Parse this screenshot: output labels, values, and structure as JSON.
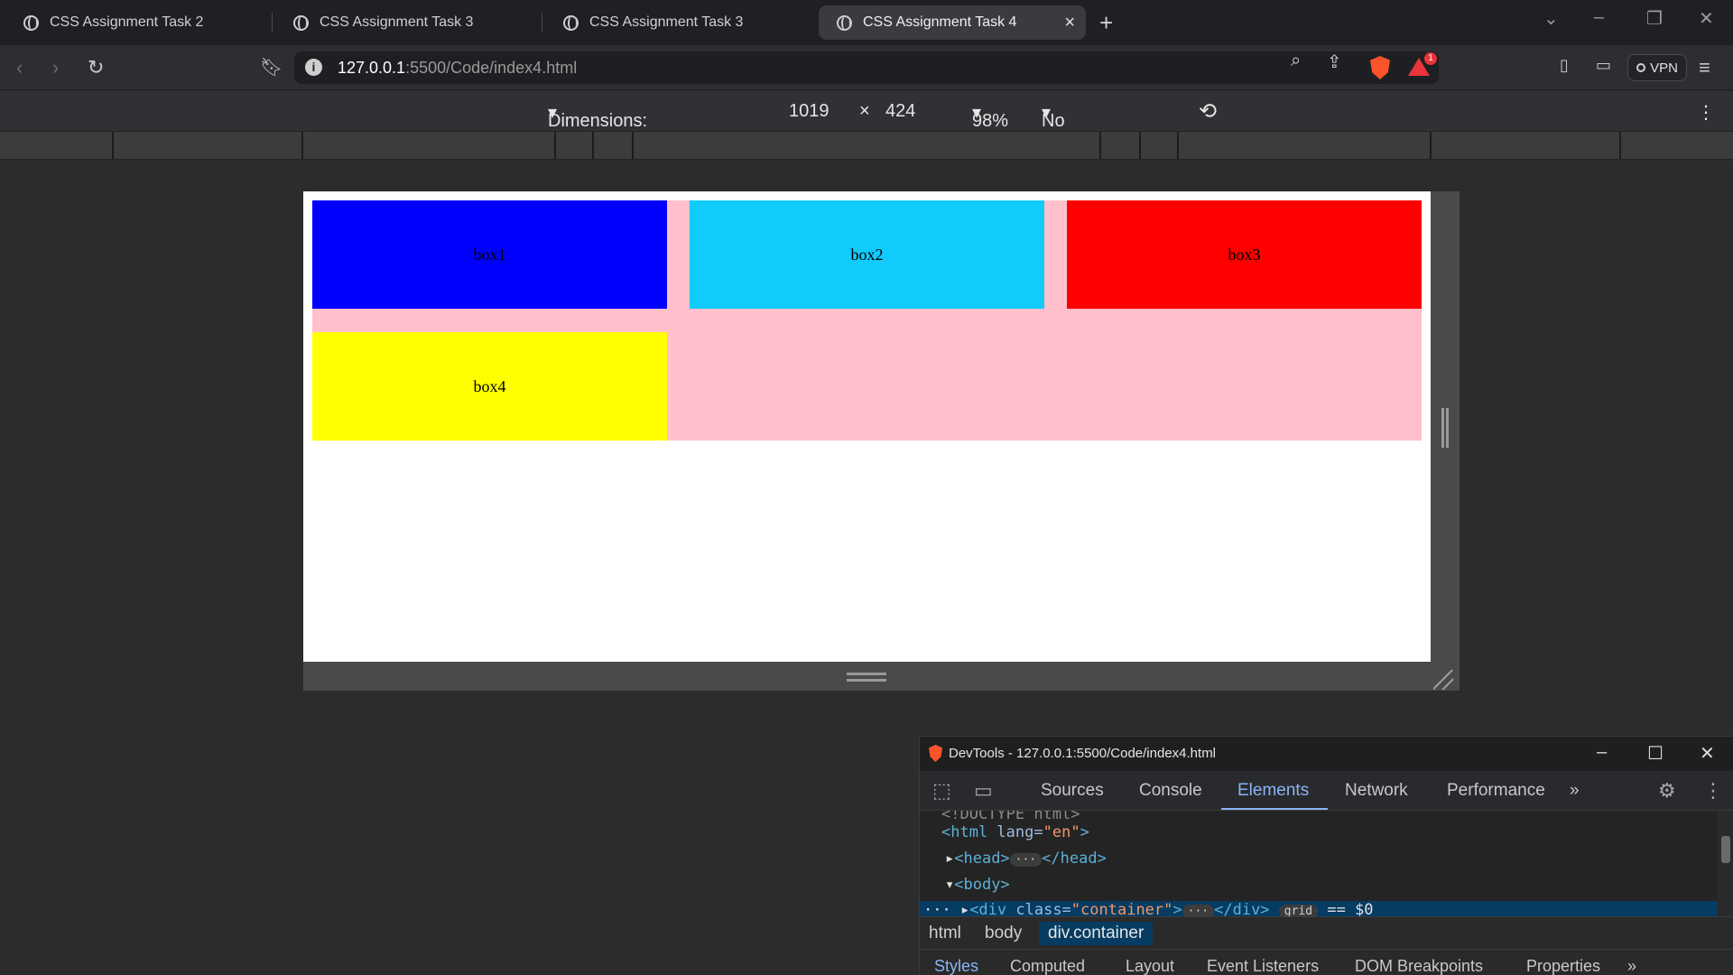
{
  "tabs": [
    {
      "title": "CSS Assignment Task 2",
      "active": false
    },
    {
      "title": "CSS Assignment Task 3",
      "active": false
    },
    {
      "title": "CSS Assignment Task 3",
      "active": false
    },
    {
      "title": "CSS Assignment Task 4",
      "active": true
    }
  ],
  "address_bar": {
    "host": "127.0.0.1",
    "path": ":5500/Code/index4.html",
    "notification_count": "1",
    "vpn_label": "VPN"
  },
  "device_toolbar": {
    "dimensions_label": "Dimensions: Responsive",
    "width": "1019",
    "times": "×",
    "height": "424",
    "zoom": "98%",
    "throttling": "No throttling"
  },
  "page": {
    "boxes": [
      {
        "label": "box1",
        "color": "#0000ff"
      },
      {
        "label": "box2",
        "color": "#10cbfb"
      },
      {
        "label": "box3",
        "color": "#ff0000"
      },
      {
        "label": "box4",
        "color": "#ffff00"
      }
    ],
    "container_color": "#ffc0cb"
  },
  "devtools": {
    "window_title": "DevTools - 127.0.0.1:5500/Code/index4.html",
    "tabs": [
      "Sources",
      "Console",
      "Elements",
      "Network",
      "Performance"
    ],
    "active_tab": "Elements",
    "more": "»",
    "dom": {
      "doctype": "<!DOCTYPE html>",
      "html_open": "<html",
      "html_attr": " lang=",
      "html_val": "\"en\"",
      "html_close": ">",
      "head": "<head>",
      "head_ellipsis": "···",
      "head_close": "</head>",
      "body": "<body>",
      "div_open": "<div",
      "div_attr": " class=",
      "div_val": "\"container\"",
      "div_gt": ">",
      "div_ellipsis": "···",
      "div_close": "</div>",
      "grid_badge": "grid",
      "eq_sel": "== $0"
    },
    "breadcrumbs": [
      "html",
      "body",
      "div.container"
    ],
    "subtabs": [
      "Styles",
      "Computed",
      "Layout",
      "Event Listeners",
      "DOM Breakpoints",
      "Properties"
    ]
  }
}
